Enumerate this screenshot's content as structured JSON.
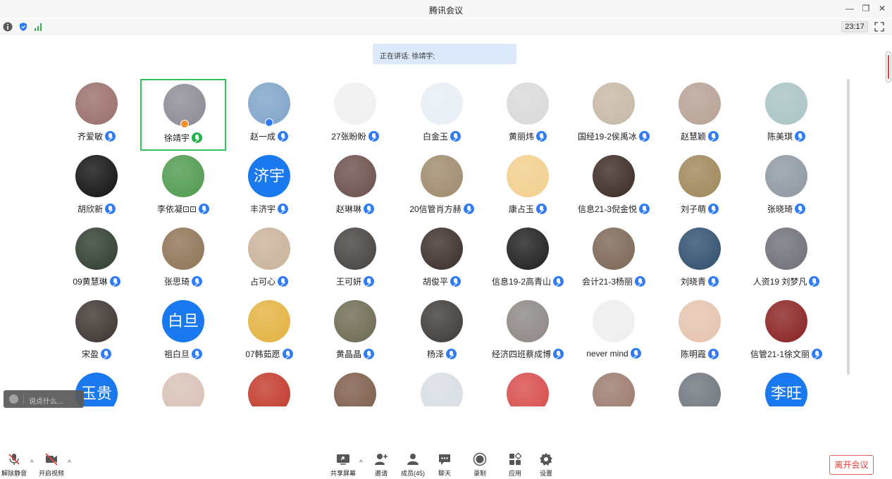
{
  "window": {
    "title": "腾讯会议"
  },
  "infobar": {
    "timer": "23:17"
  },
  "speaking": {
    "text": "正在讲话: 徐靖宇;"
  },
  "chat": {
    "placeholder": "说点什么..."
  },
  "participants": [
    {
      "name": "齐爱敏",
      "color": "#9a6f6a"
    },
    {
      "name": "徐靖宇",
      "color": "#8d8a95",
      "active": true
    },
    {
      "name": "赵一成",
      "color": "#7fa4c9"
    },
    {
      "name": "27张盼盼",
      "color": "#f0f0f0"
    },
    {
      "name": "白金玉",
      "color": "#e7eef5"
    },
    {
      "name": "黄丽炜",
      "color": "#d9d9d9"
    },
    {
      "name": "国经19-2侯禹冰",
      "color": "#c7b8a6"
    },
    {
      "name": "赵慧颖",
      "color": "#b7a194"
    },
    {
      "name": "陈美琪",
      "color": "#a9c3c3"
    },
    {
      "name": "胡欣新",
      "color": "#111111"
    },
    {
      "name": "李依凝⊡⊡",
      "color": "#4f9a4f"
    },
    {
      "name": "丰济宇",
      "text": "济宇"
    },
    {
      "name": "赵琳琳",
      "color": "#6b4f4a"
    },
    {
      "name": "20信管肖方赫",
      "color": "#9f8a6c"
    },
    {
      "name": "康占玉",
      "color": "#f2cf8d"
    },
    {
      "name": "信息21-3倪金悦",
      "color": "#3b2b22"
    },
    {
      "name": "刘子萌",
      "color": "#a0875a"
    },
    {
      "name": "张晓琦",
      "color": "#8e98a2"
    },
    {
      "name": "09黄慧琳",
      "color": "#2e3d2e"
    },
    {
      "name": "张思琦",
      "color": "#8f7355"
    },
    {
      "name": "占可心",
      "color": "#c9b29a"
    },
    {
      "name": "王可妍",
      "color": "#45413f"
    },
    {
      "name": "胡俊平",
      "color": "#3a2e2a"
    },
    {
      "name": "信息19-2高青山",
      "color": "#1e1e1e"
    },
    {
      "name": "会计21-3杨丽",
      "color": "#7c6656"
    },
    {
      "name": "刘晓青",
      "color": "#2f4f6f"
    },
    {
      "name": "人资19 刘梦凡",
      "color": "#6f6f78"
    },
    {
      "name": "宋盈",
      "color": "#3d3430"
    },
    {
      "name": "祖白旦",
      "text": "白旦"
    },
    {
      "name": "07韩茹愿",
      "color": "#e3b240"
    },
    {
      "name": "黄晶晶",
      "color": "#6d6a52"
    },
    {
      "name": "杨泽",
      "color": "#3e3a38"
    },
    {
      "name": "经济四班蔡成博",
      "color": "#8d8785"
    },
    {
      "name": "never mind",
      "color": "#eeeeee"
    },
    {
      "name": "陈明霞",
      "color": "#e5c3ae"
    },
    {
      "name": "信管21-1徐文丽",
      "color": "#8a2222"
    },
    {
      "name": "",
      "text": "玉贵"
    },
    {
      "name": "",
      "color": "#d9c1b6"
    },
    {
      "name": "",
      "color": "#c23a2b"
    },
    {
      "name": "",
      "color": "#7d5c4a"
    },
    {
      "name": "",
      "color": "#d7dde3"
    },
    {
      "name": "",
      "color": "#d84b4b"
    },
    {
      "name": "",
      "color": "#9b7a6d"
    },
    {
      "name": "",
      "color": "#6f767e"
    },
    {
      "name": "",
      "text": "李旺"
    }
  ],
  "toolbar": {
    "unmute": "解除静音",
    "video": "开启视频",
    "share": "共享屏幕",
    "invite": "邀请",
    "members": "成员(45)",
    "chat": "聊天",
    "record": "录制",
    "apps": "应用",
    "settings": "设置",
    "leave": "离开会议"
  },
  "colors": {
    "accent": "#2f7cf6",
    "active_speaker": "#22b14c",
    "leave": "#e0443f"
  }
}
